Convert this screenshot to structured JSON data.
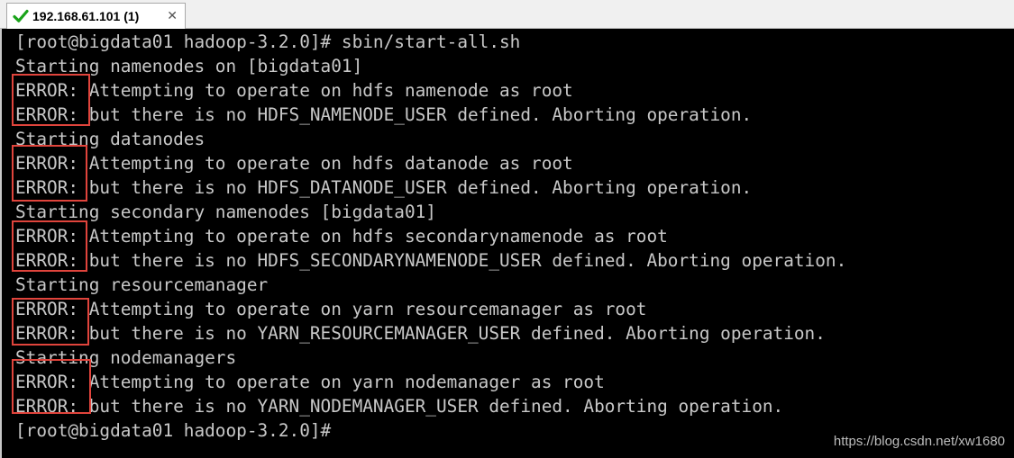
{
  "tab": {
    "title": "192.168.61.101 (1)",
    "icon": "check-icon",
    "icon_color": "#1aa31a",
    "close_label": "✕"
  },
  "terminal": {
    "background": "#000000",
    "foreground": "#c8c8c8",
    "highlight_color": "#e0443c",
    "lines": [
      "[root@bigdata01 hadoop-3.2.0]# sbin/start-all.sh",
      "Starting namenodes on [bigdata01]",
      "ERROR: Attempting to operate on hdfs namenode as root",
      "ERROR: but there is no HDFS_NAMENODE_USER defined. Aborting operation.",
      "Starting datanodes",
      "ERROR: Attempting to operate on hdfs datanode as root",
      "ERROR: but there is no HDFS_DATANODE_USER defined. Aborting operation.",
      "Starting secondary namenodes [bigdata01]",
      "ERROR: Attempting to operate on hdfs secondarynamenode as root",
      "ERROR: but there is no HDFS_SECONDARYNAMENODE_USER defined. Aborting operation.",
      "Starting resourcemanager",
      "ERROR: Attempting to operate on yarn resourcemanager as root",
      "ERROR: but there is no YARN_RESOURCEMANAGER_USER defined. Aborting operation.",
      "Starting nodemanagers",
      "ERROR: Attempting to operate on yarn nodemanager as root",
      "ERROR: but there is no YARN_NODEMANAGER_USER defined. Aborting operation.",
      "[root@bigdata01 hadoop-3.2.0]#"
    ]
  },
  "watermark": "https://blog.csdn.net/xw1680"
}
